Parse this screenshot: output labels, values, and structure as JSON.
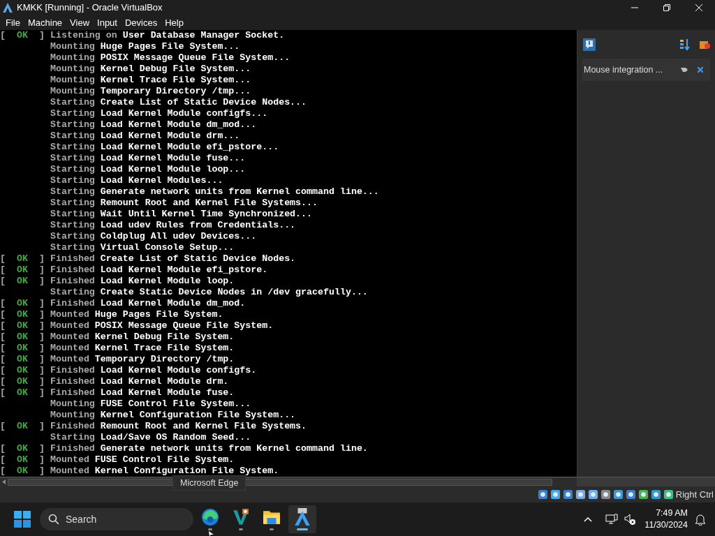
{
  "window": {
    "title": "KMKK [Running] - Oracle VirtualBox"
  },
  "menu": [
    "File",
    "Machine",
    "View",
    "Input",
    "Devices",
    "Help"
  ],
  "console": [
    {
      "open": "[",
      "status": "OK",
      "close": "]",
      "verb": "Listening on",
      "text": "User Database Manager Socket."
    },
    {
      "verb": "Mounting",
      "text": "Huge Pages File System..."
    },
    {
      "verb": "Mounting",
      "text": "POSIX Message Queue File System..."
    },
    {
      "verb": "Mounting",
      "text": "Kernel Debug File System..."
    },
    {
      "verb": "Mounting",
      "text": "Kernel Trace File System..."
    },
    {
      "verb": "Mounting",
      "text": "Temporary Directory /tmp..."
    },
    {
      "verb": "Starting",
      "text": "Create List of Static Device Nodes..."
    },
    {
      "verb": "Starting",
      "text": "Load Kernel Module configfs..."
    },
    {
      "verb": "Starting",
      "text": "Load Kernel Module dm_mod..."
    },
    {
      "verb": "Starting",
      "text": "Load Kernel Module drm..."
    },
    {
      "verb": "Starting",
      "text": "Load Kernel Module efi_pstore..."
    },
    {
      "verb": "Starting",
      "text": "Load Kernel Module fuse..."
    },
    {
      "verb": "Starting",
      "text": "Load Kernel Module loop..."
    },
    {
      "verb": "Starting",
      "text": "Load Kernel Modules..."
    },
    {
      "verb": "Starting",
      "text": "Generate network units from Kernel command line..."
    },
    {
      "verb": "Starting",
      "text": "Remount Root and Kernel File Systems..."
    },
    {
      "verb": "Starting",
      "text": "Wait Until Kernel Time Synchronized..."
    },
    {
      "verb": "Starting",
      "text": "Load udev Rules from Credentials..."
    },
    {
      "verb": "Starting",
      "text": "Coldplug All udev Devices..."
    },
    {
      "verb": "Starting",
      "text": "Virtual Console Setup..."
    },
    {
      "open": "[",
      "status": "OK",
      "close": "]",
      "verb": "Finished",
      "text": "Create List of Static Device Nodes."
    },
    {
      "open": "[",
      "status": "OK",
      "close": "]",
      "verb": "Finished",
      "text": "Load Kernel Module efi_pstore."
    },
    {
      "open": "[",
      "status": "OK",
      "close": "]",
      "verb": "Finished",
      "text": "Load Kernel Module loop."
    },
    {
      "verb": "Starting",
      "text": "Create Static Device Nodes in /dev gracefully..."
    },
    {
      "open": "[",
      "status": "OK",
      "close": "]",
      "verb": "Finished",
      "text": "Load Kernel Module dm_mod."
    },
    {
      "open": "[",
      "status": "OK",
      "close": "]",
      "verb": "Mounted",
      "text": "Huge Pages File System."
    },
    {
      "open": "[",
      "status": "OK",
      "close": "]",
      "verb": "Mounted",
      "text": "POSIX Message Queue File System."
    },
    {
      "open": "[",
      "status": "OK",
      "close": "]",
      "verb": "Mounted",
      "text": "Kernel Debug File System."
    },
    {
      "open": "[",
      "status": "OK",
      "close": "]",
      "verb": "Mounted",
      "text": "Kernel Trace File System."
    },
    {
      "open": "[",
      "status": "OK",
      "close": "]",
      "verb": "Mounted",
      "text": "Temporary Directory /tmp."
    },
    {
      "open": "[",
      "status": "OK",
      "close": "]",
      "verb": "Finished",
      "text": "Load Kernel Module configfs."
    },
    {
      "open": "[",
      "status": "OK",
      "close": "]",
      "verb": "Finished",
      "text": "Load Kernel Module drm."
    },
    {
      "open": "[",
      "status": "OK",
      "close": "]",
      "verb": "Finished",
      "text": "Load Kernel Module fuse."
    },
    {
      "verb": "Mounting",
      "text": "FUSE Control File System..."
    },
    {
      "verb": "Mounting",
      "text": "Kernel Configuration File System..."
    },
    {
      "open": "[",
      "status": "OK",
      "close": "]",
      "verb": "Finished",
      "text": "Remount Root and Kernel File Systems."
    },
    {
      "verb": "Starting",
      "text": "Load/Save OS Random Seed..."
    },
    {
      "open": "[",
      "status": "OK",
      "close": "]",
      "verb": "Finished",
      "text": "Generate network units from Kernel command line."
    },
    {
      "open": "[",
      "status": "OK",
      "close": "]",
      "verb": "Mounted",
      "text": "FUSE Control File System."
    },
    {
      "open": "[",
      "status": "OK",
      "close": "]",
      "verb": "Mounted",
      "text": "Kernel Configuration File System."
    }
  ],
  "notification": {
    "text": "Mouse integration ..."
  },
  "tooltip": "Microsoft Edge",
  "status_bar": {
    "host_key": "Right Ctrl"
  },
  "taskbar": {
    "search": {
      "placeholder": "Search"
    },
    "apps": [
      {
        "kind": "edge",
        "selected": false
      },
      {
        "kind": "studio",
        "selected": false
      },
      {
        "kind": "folder",
        "selected": false
      },
      {
        "kind": "virtualbox",
        "selected": true
      }
    ],
    "time": "7:49 AM",
    "date": "11/30/2024"
  }
}
